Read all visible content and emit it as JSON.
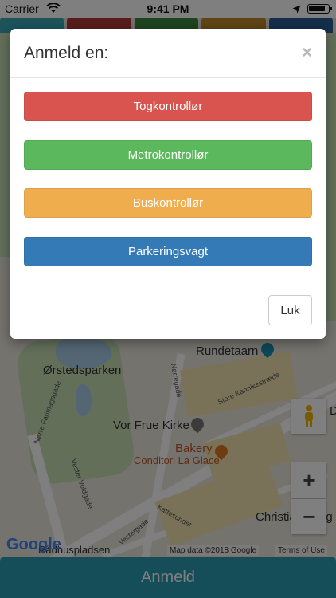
{
  "status_bar": {
    "carrier": "Carrier",
    "time": "9:41 PM"
  },
  "tab_colors": [
    "#3aa9b8",
    "#b33b36",
    "#3d8a3e",
    "#c08a2a",
    "#2b5f97"
  ],
  "map": {
    "labels": {
      "rundetaarn": "Rundetaarn",
      "orstedsparken": "Ørstedsparken",
      "vor_frue_kirke": "Vor Frue Kirke",
      "bakery": "Bakery",
      "conditori": "Conditori La Glace",
      "christiansborg": "Christiansborg S",
      "raadhuspladsen": "Rådhuspladsen",
      "norre_farimagsgade": "Nørre Farimagsgade",
      "norregade": "Nørregade",
      "store_kannikestraede": "Store Kannikestræde",
      "vester_voldgade": "Vester Voldgade",
      "vestergade": "Vestergade",
      "kattesundet": "Kattesundet",
      "d_edge": "D"
    },
    "google_logo": "Google",
    "attribution": "Map data ©2018 Google",
    "terms": "Terms of Use",
    "zoom_in": "+",
    "zoom_out": "−"
  },
  "bottom_button": {
    "label": "Anmeld",
    "color": "#2a9bb2"
  },
  "modal": {
    "title": "Anmeld en:",
    "close_symbol": "×",
    "buttons": [
      {
        "label": "Togkontrollør",
        "color": "#d9534f"
      },
      {
        "label": "Metrokontrollør",
        "color": "#5cb85c"
      },
      {
        "label": "Buskontrollør",
        "color": "#f0ad4e"
      },
      {
        "label": "Parkeringsvagt",
        "color": "#337ab7"
      }
    ],
    "footer_button": "Luk"
  }
}
